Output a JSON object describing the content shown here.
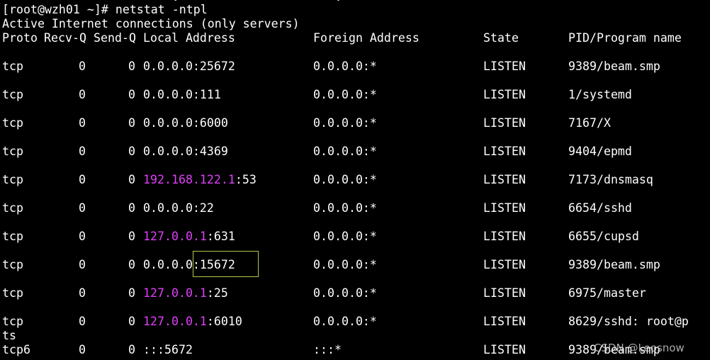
{
  "terminal": {
    "cutoff_text": "                        .                      .",
    "prompt": "[root@wzh01 ~]# ",
    "command": "netstat -ntpl",
    "info": "Active Internet connections (only servers)",
    "headers": {
      "proto": "Proto",
      "recv_q": "Recv-Q",
      "send_q": "Send-Q",
      "local": "Local Address",
      "foreign": "Foreign Address",
      "state": "State",
      "program": "PID/Program name"
    },
    "rows": [
      {
        "proto": "tcp",
        "recv_q": "0",
        "send_q": "0",
        "local_ip": "0.0.0.0",
        "local_port": ":25672",
        "foreign": "0.0.0.0:*",
        "state": "LISTEN",
        "program": "9389/beam.smp"
      },
      {
        "proto": "tcp",
        "recv_q": "0",
        "send_q": "0",
        "local_ip": "0.0.0.0",
        "local_port": ":111",
        "foreign": "0.0.0.0:*",
        "state": "LISTEN",
        "program": "1/systemd"
      },
      {
        "proto": "tcp",
        "recv_q": "0",
        "send_q": "0",
        "local_ip": "0.0.0.0",
        "local_port": ":6000",
        "foreign": "0.0.0.0:*",
        "state": "LISTEN",
        "program": "7167/X"
      },
      {
        "proto": "tcp",
        "recv_q": "0",
        "send_q": "0",
        "local_ip": "0.0.0.0",
        "local_port": ":4369",
        "foreign": "0.0.0.0:*",
        "state": "LISTEN",
        "program": "9404/epmd"
      },
      {
        "proto": "tcp",
        "recv_q": "0",
        "send_q": "0",
        "local_ip": "192.168.122.1",
        "local_port": ":53",
        "foreign": "0.0.0.0:*",
        "state": "LISTEN",
        "program": "7173/dnsmasq"
      },
      {
        "proto": "tcp",
        "recv_q": "0",
        "send_q": "0",
        "local_ip": "0.0.0.0",
        "local_port": ":22",
        "foreign": "0.0.0.0:*",
        "state": "LISTEN",
        "program": "6654/sshd"
      },
      {
        "proto": "tcp",
        "recv_q": "0",
        "send_q": "0",
        "local_ip": "127.0.0.1",
        "local_port": ":631",
        "foreign": "0.0.0.0:*",
        "state": "LISTEN",
        "program": "6655/cupsd"
      },
      {
        "proto": "tcp",
        "recv_q": "0",
        "send_q": "0",
        "local_ip": "0.0.0.0",
        "local_port": ":15672",
        "foreign": "0.0.0.0:*",
        "state": "LISTEN",
        "program": "9389/beam.smp"
      },
      {
        "proto": "tcp",
        "recv_q": "0",
        "send_q": "0",
        "local_ip": "127.0.0.1",
        "local_port": ":25",
        "foreign": "0.0.0.0:*",
        "state": "LISTEN",
        "program": "6975/master"
      },
      {
        "proto": "tcp",
        "recv_q": "0",
        "send_q": "0",
        "local_ip": "127.0.0.1",
        "local_port": ":6010",
        "foreign": "0.0.0.0:*",
        "state": "LISTEN",
        "program": "8629/sshd: root@p"
      },
      {
        "proto": "tcp6",
        "recv_q": "0",
        "send_q": "0",
        "local_ip": ":::",
        "local_port": "5672",
        "foreign": ":::*",
        "state": "LISTEN",
        "program": "9389/beam.smp"
      }
    ],
    "wrap_text": "ts",
    "watermark": "CSDN @Leosnow"
  },
  "colors": {
    "background": "#000000",
    "text": "#ffffff",
    "ip_highlight": "#e040fb",
    "box_outline": "#b6c64b"
  }
}
